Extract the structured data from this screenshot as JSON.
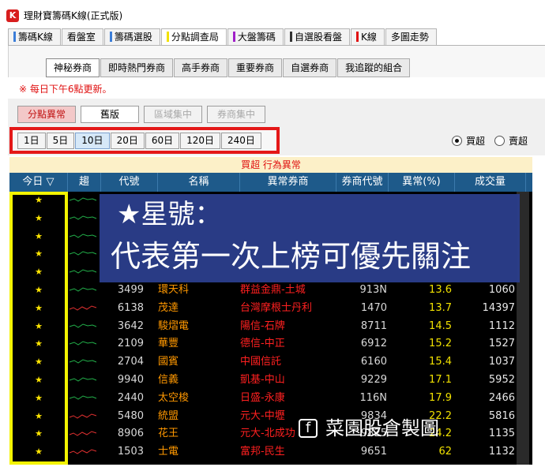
{
  "window": {
    "app_icon": "K",
    "title": "理財寶籌碼K線(正式版)"
  },
  "main_tabs": [
    {
      "label": "籌碼K線",
      "bar_color": "#3b7dd8",
      "active": false
    },
    {
      "label": "看盤室",
      "bar_color": "",
      "active": false
    },
    {
      "label": "籌碼選股",
      "bar_color": "#3b7dd8",
      "active": false
    },
    {
      "label": "分點調查局",
      "bar_color": "#f2e200",
      "active": true
    },
    {
      "label": "大盤籌碼",
      "bar_color": "#a020c8",
      "active": false
    },
    {
      "label": "自選股看盤",
      "bar_color": "#333333",
      "active": false
    },
    {
      "label": "K線",
      "bar_color": "#e01010",
      "active": false
    },
    {
      "label": "多圖走勢",
      "bar_color": "",
      "active": false
    }
  ],
  "sub_tabs": [
    {
      "label": "神秘券商",
      "active": true
    },
    {
      "label": "即時熱門券商",
      "active": false
    },
    {
      "label": "高手券商",
      "active": false
    },
    {
      "label": "重要券商",
      "active": false
    },
    {
      "label": "自選券商",
      "active": false
    },
    {
      "label": "我追蹤的組合",
      "active": false
    }
  ],
  "update_note": "※ 每日下午6點更新。",
  "mode_buttons": [
    {
      "label": "分點異常",
      "state": "active"
    },
    {
      "label": "舊版",
      "state": "normal"
    },
    {
      "label": "區域集中",
      "state": "disabled"
    },
    {
      "label": "券商集中",
      "state": "disabled"
    }
  ],
  "periods": [
    {
      "label": "1日",
      "active": false
    },
    {
      "label": "5日",
      "active": false
    },
    {
      "label": "10日",
      "active": true
    },
    {
      "label": "20日",
      "active": false
    },
    {
      "label": "60日",
      "active": false
    },
    {
      "label": "120日",
      "active": false
    },
    {
      "label": "240日",
      "active": false
    }
  ],
  "radios": [
    {
      "label": "買超",
      "checked": true
    },
    {
      "label": "賣超",
      "checked": false
    }
  ],
  "table": {
    "caption": "買超 行為異常",
    "columns": [
      "今日 ▽",
      "趨",
      "代號",
      "名稱",
      "異常券商",
      "券商代號",
      "異常(%)",
      "成交量"
    ],
    "rows": [
      {
        "star": "★",
        "trend": "green",
        "code": "",
        "name": "",
        "broker": "",
        "bcode": "",
        "pct": "",
        "vol": ""
      },
      {
        "star": "★",
        "trend": "green",
        "code": "",
        "name": "",
        "broker": "",
        "bcode": "",
        "pct": "",
        "vol": ""
      },
      {
        "star": "★",
        "trend": "green",
        "code": "",
        "name": "",
        "broker": "",
        "bcode": "",
        "pct": "",
        "vol": ""
      },
      {
        "star": "★",
        "trend": "green",
        "code": "",
        "name": "",
        "broker": "",
        "bcode": "",
        "pct": "",
        "vol": ""
      },
      {
        "star": "★",
        "trend": "green",
        "code": "",
        "name": "",
        "broker": "",
        "bcode": "",
        "pct": "",
        "vol": ""
      },
      {
        "star": "★",
        "trend": "green",
        "code": "3499",
        "name": "環天科",
        "broker": "群益金鼎-土城",
        "bcode": "913N",
        "pct": "13.6",
        "vol": "1060"
      },
      {
        "star": "★",
        "trend": "red",
        "code": "6138",
        "name": "茂達",
        "broker": "台灣摩根士丹利",
        "bcode": "1470",
        "pct": "13.7",
        "vol": "14397"
      },
      {
        "star": "★",
        "trend": "green",
        "code": "3642",
        "name": "駿熠電",
        "broker": "陽信-石牌",
        "bcode": "8711",
        "pct": "14.5",
        "vol": "1112"
      },
      {
        "star": "★",
        "trend": "green",
        "code": "2109",
        "name": "華豐",
        "broker": "德信-中正",
        "bcode": "6912",
        "pct": "15.2",
        "vol": "1527"
      },
      {
        "star": "★",
        "trend": "green",
        "code": "2704",
        "name": "國賓",
        "broker": "中國信託",
        "bcode": "6160",
        "pct": "15.4",
        "vol": "1037"
      },
      {
        "star": "★",
        "trend": "green",
        "code": "9940",
        "name": "信義",
        "broker": "凱基-中山",
        "bcode": "9229",
        "pct": "17.1",
        "vol": "5952"
      },
      {
        "star": "★",
        "trend": "green",
        "code": "2440",
        "name": "太空梭",
        "broker": "日盛-永康",
        "bcode": "116N",
        "pct": "17.9",
        "vol": "2466"
      },
      {
        "star": "★",
        "trend": "red",
        "code": "5480",
        "name": "統盟",
        "broker": "元大-中壢",
        "bcode": "9834",
        "pct": "22.2",
        "vol": "5816"
      },
      {
        "star": "★",
        "trend": "red",
        "code": "8906",
        "name": "花王",
        "broker": "元大-北成功",
        "bcode": "9825",
        "pct": "24.2",
        "vol": "1135"
      },
      {
        "star": "★",
        "trend": "red",
        "code": "1503",
        "name": "士電",
        "broker": "富邦-民生",
        "bcode": "9651",
        "pct": "62",
        "vol": "1132"
      }
    ]
  },
  "banner": {
    "line1": "★星號：",
    "line2": "代表第一次上榜可優先關注"
  },
  "watermark": {
    "icon": "f",
    "text": "菜園股倉製圖"
  }
}
